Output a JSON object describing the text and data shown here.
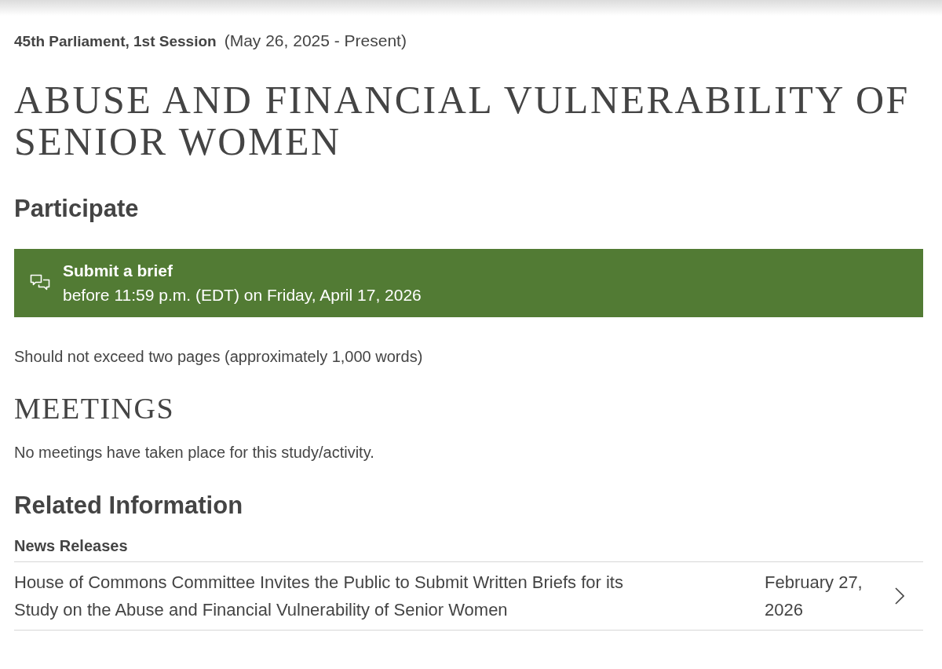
{
  "session": {
    "name": "45th Parliament, 1st Session",
    "dates": "(May 26, 2025 - Present)"
  },
  "title": "ABUSE AND FINANCIAL VULNERABILITY OF SENIOR WOMEN",
  "participate": {
    "heading": "Participate",
    "banner": {
      "action": "Submit a brief",
      "deadline": "before 11:59 p.m. (EDT) on Friday, April 17, 2026"
    },
    "note": "Should not exceed two pages (approximately 1,000 words)"
  },
  "meetings": {
    "heading": "MEETINGS",
    "message": "No meetings have taken place for this study/activity."
  },
  "related": {
    "heading": "Related Information",
    "sections": [
      {
        "heading": "News Releases",
        "items": [
          {
            "title": "House of Commons Committee Invites the Public to Submit Written Briefs for its Study on the Abuse and Financial Vulnerability of Senior Women",
            "date": "February 27, 2026"
          }
        ]
      }
    ]
  }
}
